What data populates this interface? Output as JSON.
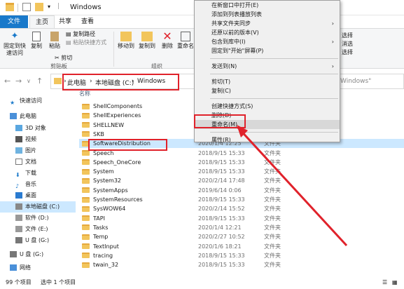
{
  "window": {
    "title": "Windows"
  },
  "ribbon_tabs": [
    "文件",
    "主页",
    "共享",
    "查看"
  ],
  "ribbon": {
    "pin_label": "固定到快速访问",
    "copy_label": "复制",
    "paste_label": "粘贴",
    "copy_path_label": "复制路径",
    "paste_shortcut_label": "粘贴快捷方式",
    "cut_label": "剪切",
    "clipboard_group": "剪贴板",
    "move_to_label": "移动到",
    "copy_to_label": "复制到",
    "delete_label": "删除",
    "rename_label": "重命名",
    "organize_group": "组织",
    "right_labels": [
      "选择",
      "消选",
      "选择"
    ]
  },
  "address": {
    "crumbs": [
      "此电脑",
      "本地磁盘 (C:)",
      "Windows"
    ],
    "search_placeholder": "Windows\""
  },
  "nav": [
    {
      "label": "快速访问",
      "selected": false
    },
    {
      "label": "此电脑",
      "selected": false
    },
    {
      "label": "3D 对象",
      "selected": false
    },
    {
      "label": "视频",
      "selected": false
    },
    {
      "label": "图片",
      "selected": false
    },
    {
      "label": "文档",
      "selected": false
    },
    {
      "label": "下载",
      "selected": false
    },
    {
      "label": "音乐",
      "selected": false
    },
    {
      "label": "桌面",
      "selected": false
    },
    {
      "label": "本地磁盘 (C:)",
      "selected": true
    },
    {
      "label": "软件 (D:)",
      "selected": false
    },
    {
      "label": "文件 (E:)",
      "selected": false
    },
    {
      "label": "U 盘 (G:)",
      "selected": false
    },
    {
      "label": "U 盘 (G:)",
      "selected": false
    },
    {
      "label": "网络",
      "selected": false
    }
  ],
  "list": {
    "column_name": "名称",
    "rows": [
      {
        "name": "ShellComponents",
        "date": "",
        "type": ""
      },
      {
        "name": "ShellExperiences",
        "date": "",
        "type": ""
      },
      {
        "name": "SHELLNEW",
        "date": "",
        "type": ""
      },
      {
        "name": "SKB",
        "date": "",
        "type": ""
      },
      {
        "name": "SoftwareDistribution",
        "date": "2020/1/4 12:25",
        "type": "文件夹"
      },
      {
        "name": "Speech",
        "date": "2018/9/15 15:33",
        "type": "文件夹"
      },
      {
        "name": "Speech_OneCore",
        "date": "2018/9/15 15:33",
        "type": "文件夹"
      },
      {
        "name": "System",
        "date": "2018/9/15 15:33",
        "type": "文件夹"
      },
      {
        "name": "System32",
        "date": "2020/2/14 17:48",
        "type": "文件夹"
      },
      {
        "name": "SystemApps",
        "date": "2019/6/14 0:06",
        "type": "文件夹"
      },
      {
        "name": "SystemResources",
        "date": "2018/9/15 15:33",
        "type": "文件夹"
      },
      {
        "name": "SysWOW64",
        "date": "2020/2/14 15:52",
        "type": "文件夹"
      },
      {
        "name": "TAPI",
        "date": "2018/9/15 15:33",
        "type": "文件夹"
      },
      {
        "name": "Tasks",
        "date": "2020/1/4 12:21",
        "type": "文件夹"
      },
      {
        "name": "Temp",
        "date": "2020/2/27 10:52",
        "type": "文件夹"
      },
      {
        "name": "TextInput",
        "date": "2020/1/6 18:21",
        "type": "文件夹"
      },
      {
        "name": "tracing",
        "date": "2018/9/15 15:33",
        "type": "文件夹"
      },
      {
        "name": "twain_32",
        "date": "2018/9/15 15:33",
        "type": "文件夹"
      }
    ]
  },
  "status": {
    "count": "99 个项目",
    "selected": "选中 1 个项目"
  },
  "context_menu": [
    {
      "label": "在新窗口中打开(E)",
      "arrow": false,
      "hl": false
    },
    {
      "label": "添加到列表播放列表",
      "arrow": false,
      "hl": false
    },
    {
      "label": "共享文件夹同步",
      "arrow": true,
      "hl": false
    },
    {
      "label": "还原以前的版本(V)",
      "arrow": false,
      "hl": false
    },
    {
      "label": "包含到库中(I)",
      "arrow": true,
      "hl": false
    },
    {
      "label": "固定到\"开始\"屏幕(P)",
      "arrow": false,
      "hl": false
    },
    {
      "sep": true
    },
    {
      "label": "发送到(N)",
      "arrow": true,
      "hl": false
    },
    {
      "sep": true
    },
    {
      "label": "剪切(T)",
      "arrow": false,
      "hl": false
    },
    {
      "label": "复制(C)",
      "arrow": false,
      "hl": false
    },
    {
      "sep": true
    },
    {
      "label": "创建快捷方式(S)",
      "arrow": false,
      "hl": false
    },
    {
      "label": "删除(D)",
      "arrow": false,
      "hl": false
    },
    {
      "label": "重命名(M)",
      "arrow": false,
      "hl": true
    },
    {
      "sep": true
    },
    {
      "label": "属性(R)",
      "arrow": false,
      "hl": false
    }
  ],
  "colors": {
    "accent": "#1979ca",
    "highlight": "#cce8ff",
    "annotation": "#e0222b",
    "folder": "#f2c55c"
  }
}
